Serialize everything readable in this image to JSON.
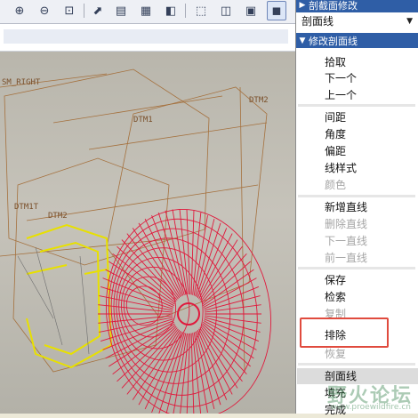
{
  "toolbar": {
    "buttons": [
      {
        "name": "zoom-in-icon",
        "glyph": "⊕"
      },
      {
        "name": "zoom-out-icon",
        "glyph": "⊖"
      },
      {
        "name": "zoom-window-icon",
        "glyph": "⊡"
      },
      {
        "name": "reorient-icon",
        "glyph": "⬈"
      },
      {
        "name": "view-manager-icon",
        "glyph": "▤"
      },
      {
        "name": "layers-icon",
        "glyph": "▦"
      },
      {
        "name": "wireframe-icon",
        "glyph": "⬚"
      },
      {
        "name": "hidden-line-icon",
        "glyph": "◫"
      },
      {
        "name": "no-hidden-icon",
        "glyph": "▣"
      },
      {
        "name": "shading-icon",
        "glyph": "◼"
      }
    ]
  },
  "viewport": {
    "labels": [
      "SM_RIGHT",
      "DTM2",
      "DTM1",
      "DTM1T",
      "DTM2"
    ]
  },
  "panel": {
    "top_header": "剖截面修改",
    "dropdown_value": "剖面线",
    "section_header": "修改剖面线",
    "items_group1": [
      {
        "label": "拾取",
        "enabled": true
      },
      {
        "label": "下一个",
        "enabled": true
      },
      {
        "label": "上一个",
        "enabled": true
      }
    ],
    "items_group2": [
      {
        "label": "间距",
        "enabled": true
      },
      {
        "label": "角度",
        "enabled": true
      },
      {
        "label": "偏距",
        "enabled": true
      },
      {
        "label": "线样式",
        "enabled": true
      },
      {
        "label": "颜色",
        "enabled": false
      }
    ],
    "items_group3": [
      {
        "label": "新增直线",
        "enabled": true
      },
      {
        "label": "删除直线",
        "enabled": false
      },
      {
        "label": "下一直线",
        "enabled": false
      },
      {
        "label": "前一直线",
        "enabled": false
      }
    ],
    "items_group4": [
      {
        "label": "保存",
        "enabled": true
      },
      {
        "label": "检索",
        "enabled": true
      },
      {
        "label": "复制",
        "enabled": false
      },
      {
        "label": "排除",
        "enabled": true
      },
      {
        "label": "恢复",
        "enabled": false
      }
    ],
    "items_group5": [
      {
        "label": "剖面线",
        "enabled": true
      },
      {
        "label": "填充",
        "enabled": true
      },
      {
        "label": "完成",
        "enabled": true
      }
    ]
  },
  "watermark": {
    "text": "野火论坛",
    "url": "www.proewildfire.cn"
  },
  "colors": {
    "accent": "#2f5ea6",
    "fan": "#e0193c",
    "highlight": "#e04b3e"
  }
}
